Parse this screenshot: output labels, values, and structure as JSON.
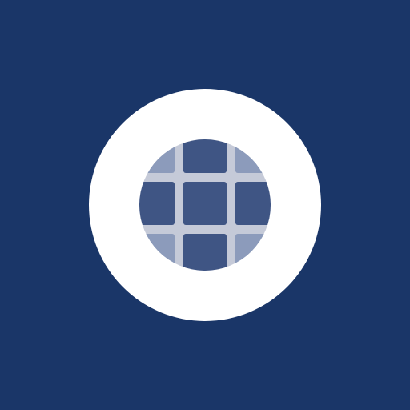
{
  "icon": {
    "name": "grid-lens-logo",
    "colors": {
      "background": "#1a3668",
      "ring": "#ffffff",
      "lens_lines": "#c5cad8",
      "tile_dark": "#3f5584",
      "tile_light": "#8c9bbb"
    }
  }
}
